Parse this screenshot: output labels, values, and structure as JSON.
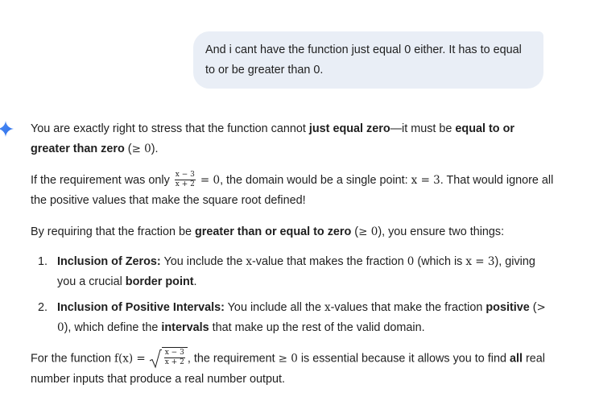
{
  "user_message": "And i cant have the function just equal 0 either. It has to equal to or be greater than 0.",
  "response": {
    "p1": {
      "t1": "You are exactly right to stress that the function cannot ",
      "b1": "just equal zero",
      "t2": "—it must be ",
      "b2": "equal to or greater than zero",
      "t3": " (",
      "m1": "≥ 0",
      "t4": ")."
    },
    "p2": {
      "t1": "If the requirement was only ",
      "frac_num": "x − 3",
      "frac_den": "x + 2",
      "m1": "= 0",
      "t2": ", the domain would be a single point: ",
      "m2": "x = 3",
      "t3": ". That would ignore all the positive values that make the square root defined!"
    },
    "p3": {
      "t1": "By requiring that the fraction be ",
      "b1": "greater than or equal to zero",
      "t2": " (",
      "m1": "≥ 0",
      "t3": "), you ensure two things:"
    },
    "list": [
      {
        "marker": "1.",
        "b1": "Inclusion of Zeros:",
        "t1": " You include the ",
        "m1": "x",
        "t2": "-value that makes the fraction ",
        "m2": "0",
        "t3": " (which is ",
        "m3": "x = 3",
        "t4": "), giving you a crucial ",
        "b2": "border point",
        "t5": "."
      },
      {
        "marker": "2.",
        "b1": "Inclusion of Positive Intervals:",
        "t1": " You include all the ",
        "m1": "x",
        "t2": "-values that make the fraction ",
        "b2": "positive",
        "t3": " (",
        "m2": "> 0",
        "t4": "), which define the ",
        "b3": "intervals",
        "t5": " that make up the rest of the valid domain."
      }
    ],
    "p4": {
      "t1": "For the function ",
      "m1": "f(x) =",
      "frac_num": "x − 3",
      "frac_den": "x + 2",
      "t2": ", the requirement ",
      "m2": "≥ 0",
      "t3": " is essential because it allows you to find ",
      "b1": "all",
      "t4": " real number inputs that produce a real number output."
    }
  },
  "colors": {
    "user_bubble": "#e9eef6",
    "gemini_icon": "#3f7ff0",
    "text": "#1f1f1f"
  }
}
